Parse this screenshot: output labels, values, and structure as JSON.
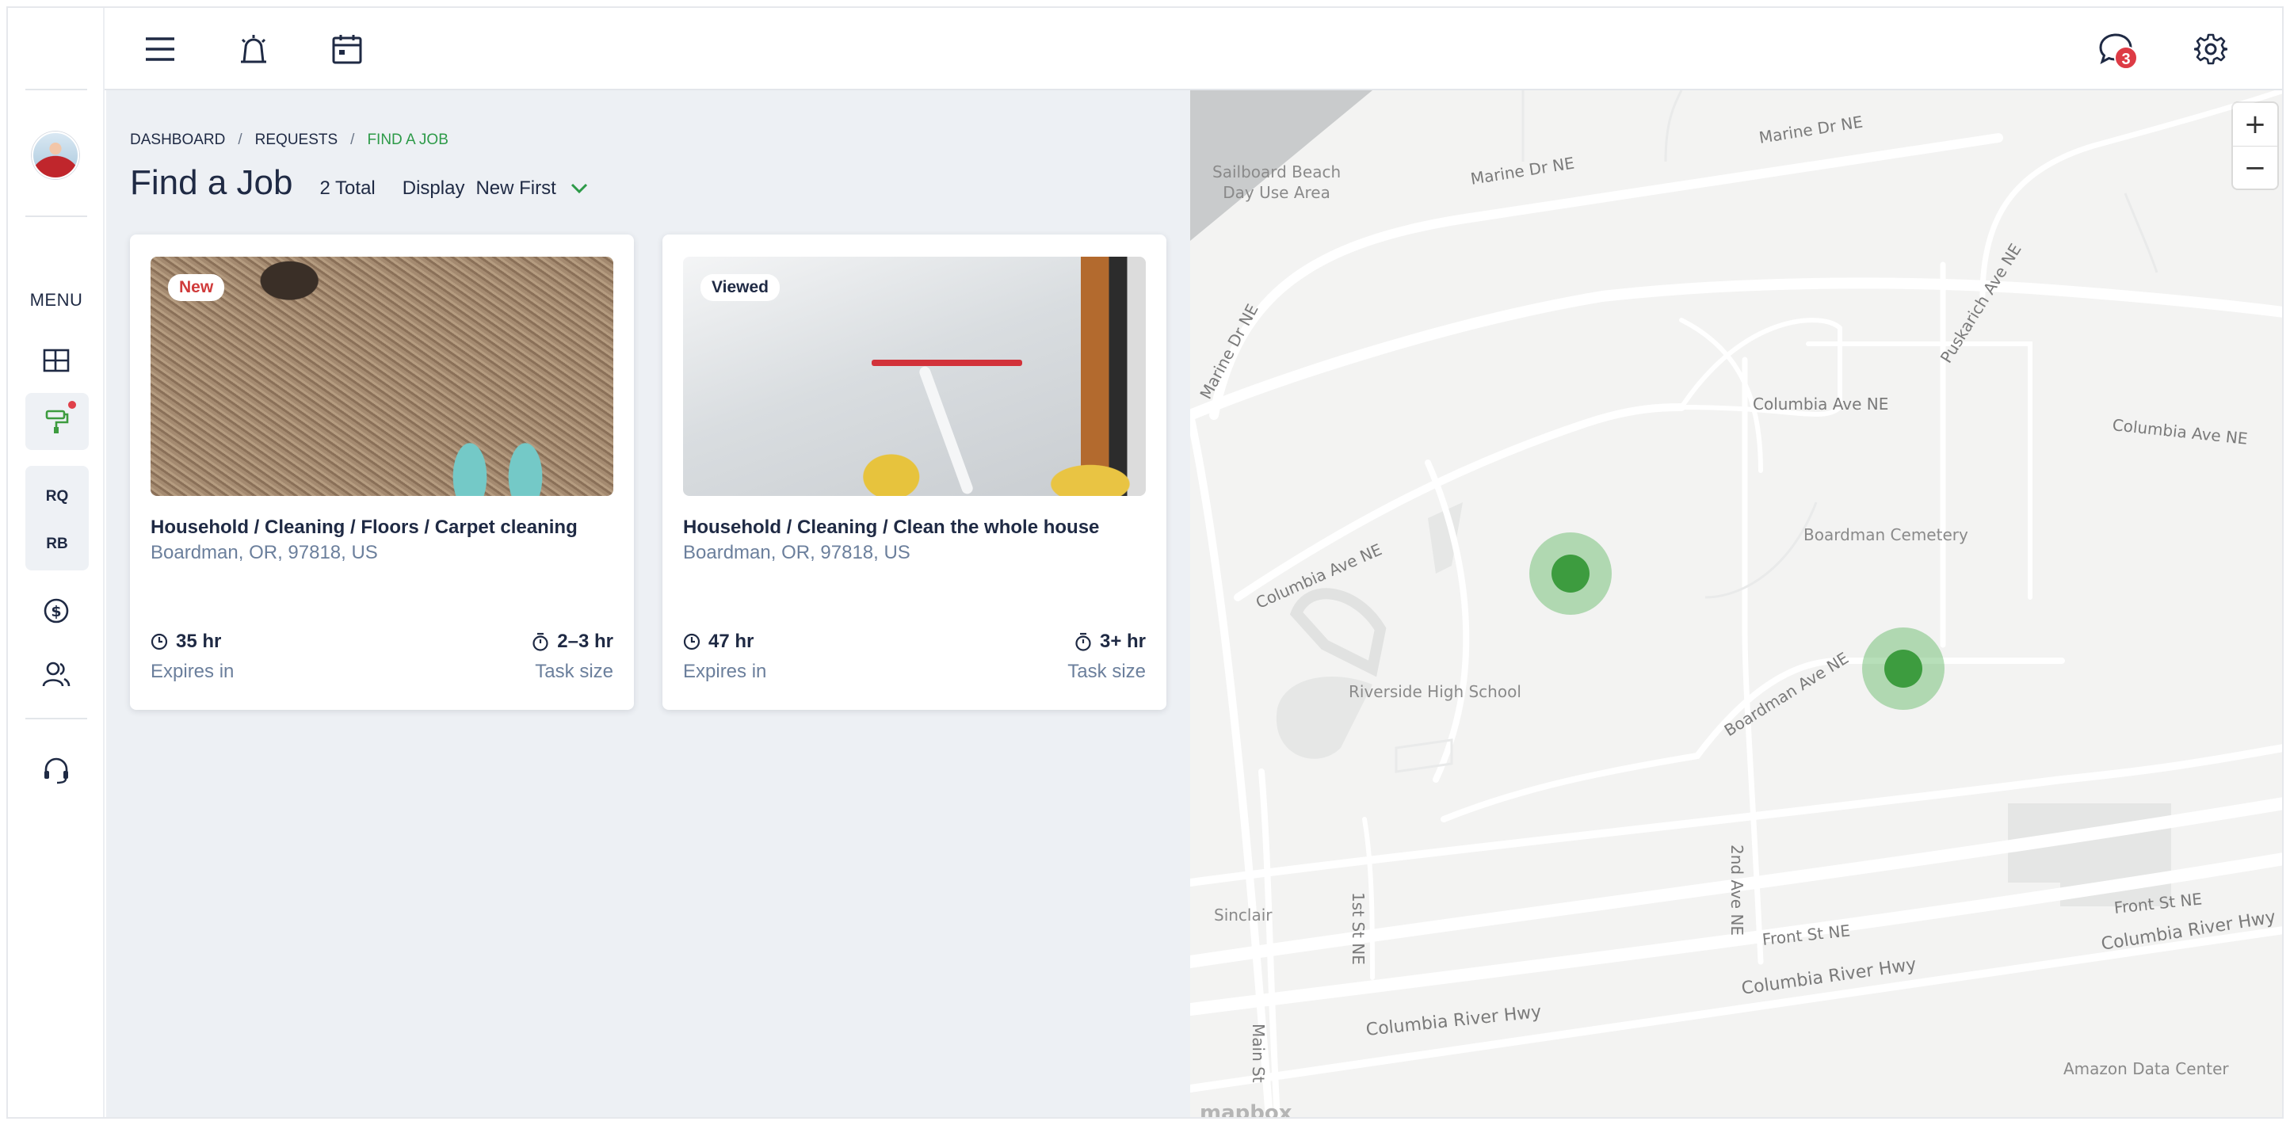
{
  "sidebar": {
    "menu_label": "MENU",
    "group_items": [
      "RQ",
      "RB"
    ]
  },
  "topbar": {
    "messages_badge": "3"
  },
  "breadcrumb": {
    "items": [
      "DASHBOARD",
      "REQUESTS",
      "FIND A JOB"
    ],
    "separator": "/"
  },
  "header": {
    "title": "Find a Job",
    "total": "2 Total",
    "display_label": "Display",
    "display_value": "New First"
  },
  "jobs": [
    {
      "tag": "New",
      "title": "Household / Cleaning / Floors / Carpet cleaning",
      "location": "Boardman, OR, 97818, US",
      "expires_value": "35 hr",
      "expires_label": "Expires in",
      "size_value": "2–3 hr",
      "size_label": "Task size"
    },
    {
      "tag": "Viewed",
      "title": "Household / Cleaning / Clean the whole house",
      "location": "Boardman, OR, 97818, US",
      "expires_value": "47 hr",
      "expires_label": "Expires in",
      "size_value": "3+ hr",
      "size_label": "Task size"
    }
  ],
  "map": {
    "zoom_in": "+",
    "zoom_out": "−",
    "attribution": "mapbox",
    "streets": [
      "Marine Dr NE",
      "Marine Dr NE",
      "Marine Dr NE",
      "Puskarich Ave NE",
      "Columbia Ave NE",
      "Columbia Ave NE",
      "Columbia Ave NE",
      "Boardman Ave NE",
      "2nd Ave NE",
      "1st St NE",
      "Front St NE",
      "Front St NE",
      "Columbia River Hwy",
      "Columbia River Hwy",
      "Columbia River Hwy",
      "Main St"
    ],
    "places": [
      "Sailboard Beach\nDay Use Area",
      "Boardman Cemetery",
      "Riverside High School",
      "Sinclair",
      "Amazon Data Center"
    ]
  },
  "colors": {
    "accent_green": "#2d9a48",
    "badge_red": "#dd3b45",
    "pin_green": "#3d9c3f"
  }
}
